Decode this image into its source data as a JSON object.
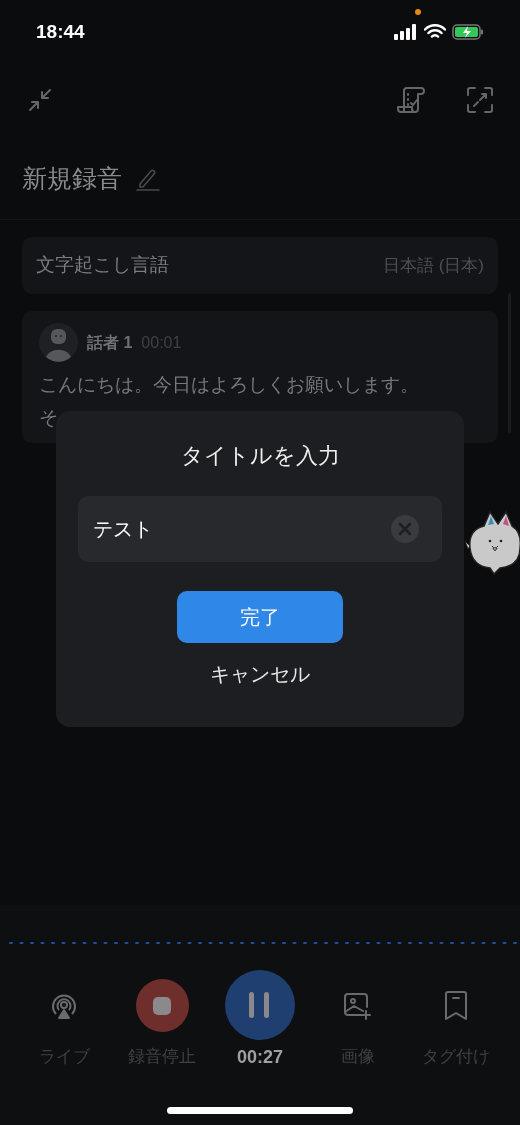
{
  "status_bar": {
    "time": "18:44"
  },
  "title": "新規録音",
  "language_row": {
    "label": "文字起こし言語",
    "value": "日本語 (日本)"
  },
  "transcript": {
    "speaker": "話者 1",
    "timestamp": "00:01",
    "lines": [
      "こんにちは。今日はよろしくお願いします。",
      "そ"
    ]
  },
  "dialog": {
    "title": "タイトルを入力",
    "field": {
      "value": "テスト"
    },
    "confirm": "完了",
    "cancel": "キャンセル"
  },
  "controls": [
    {
      "kind": "live",
      "label": "ライブ"
    },
    {
      "kind": "stop",
      "label": "録音停止"
    },
    {
      "kind": "pause",
      "label": "00:27"
    },
    {
      "kind": "image",
      "label": "画像"
    },
    {
      "kind": "tag",
      "label": "タグ付け"
    }
  ]
}
